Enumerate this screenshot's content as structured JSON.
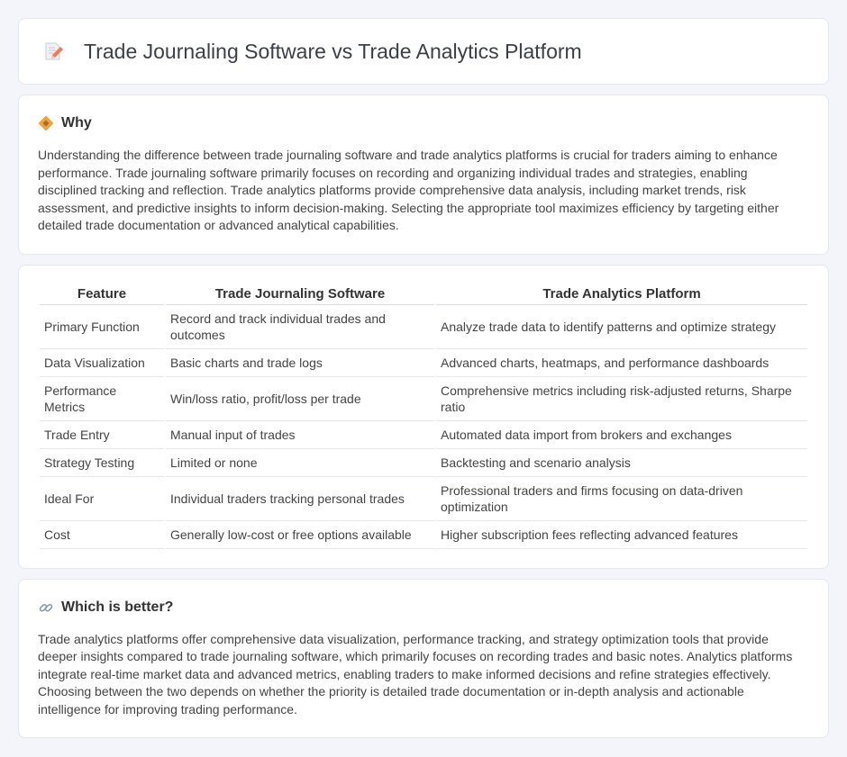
{
  "header": {
    "title": "Trade Journaling Software vs Trade Analytics Platform",
    "icon": "memo-pencil-icon"
  },
  "why": {
    "heading": "Why",
    "icon": "diamond-warning-icon",
    "text": "Understanding the difference between trade journaling software and trade analytics platforms is crucial for traders aiming to enhance performance. Trade journaling software primarily focuses on recording and organizing individual trades and strategies, enabling disciplined tracking and reflection. Trade analytics platforms provide comprehensive data analysis, including market trends, risk assessment, and predictive insights to inform decision-making. Selecting the appropriate tool maximizes efficiency by targeting either detailed trade documentation or advanced analytical capabilities."
  },
  "table": {
    "headers": [
      "Feature",
      "Trade Journaling Software",
      "Trade Analytics Platform"
    ],
    "rows": [
      [
        "Primary Function",
        "Record and track individual trades and outcomes",
        "Analyze trade data to identify patterns and optimize strategy"
      ],
      [
        "Data Visualization",
        "Basic charts and trade logs",
        "Advanced charts, heatmaps, and performance dashboards"
      ],
      [
        "Performance Metrics",
        "Win/loss ratio, profit/loss per trade",
        "Comprehensive metrics including risk-adjusted returns, Sharpe ratio"
      ],
      [
        "Trade Entry",
        "Manual input of trades",
        "Automated data import from brokers and exchanges"
      ],
      [
        "Strategy Testing",
        "Limited or none",
        "Backtesting and scenario analysis"
      ],
      [
        "Ideal For",
        "Individual traders tracking personal trades",
        "Professional traders and firms focusing on data-driven optimization"
      ],
      [
        "Cost",
        "Generally low-cost or free options available",
        "Higher subscription fees reflecting advanced features"
      ]
    ]
  },
  "better": {
    "heading": "Which is better?",
    "icon": "link-icon",
    "text": "Trade analytics platforms offer comprehensive data visualization, performance tracking, and strategy optimization tools that provide deeper insights compared to trade journaling software, which primarily focuses on recording trades and basic notes. Analytics platforms integrate real-time market data and advanced metrics, enabling traders to make informed decisions and refine strategies effectively. Choosing between the two depends on whether the priority is detailed trade documentation or in-depth analysis and actionable intelligence for improving trading performance."
  }
}
